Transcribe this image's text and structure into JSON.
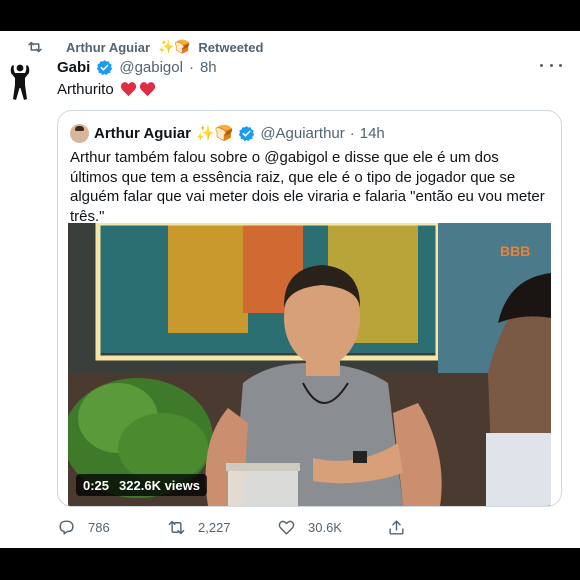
{
  "retweet": {
    "user": "Arthur Aguiar",
    "emoji": "✨🍞",
    "label": "Retweeted",
    "icon": "retweet-icon"
  },
  "tweet": {
    "name": "Gabi",
    "handle": "@gabigol",
    "dot": "·",
    "time": "8h",
    "text": "Arthurito",
    "hearts": [
      "heart-icon",
      "heart-icon"
    ],
    "more_icon": "more-icon"
  },
  "quote": {
    "name": "Arthur Aguiar",
    "emoji": "✨🍞",
    "handle": "@Aguiarthur",
    "dot": "·",
    "time": "14h",
    "text": "Arthur também falou sobre o @gabigol e disse que ele é um dos últimos que tem a essência raiz, que ele é o tipo de jogador que se alguém falar que vai meter dois ele viraria e falaria \"então eu vou meter três.\"",
    "video": {
      "duration": "0:25",
      "views": "322.6K views",
      "logo": "BBB"
    }
  },
  "actions": {
    "reply": {
      "icon": "reply-icon",
      "count": "786"
    },
    "retweet": {
      "icon": "retweet-icon",
      "count": "2,227"
    },
    "like": {
      "icon": "like-icon",
      "count": "30.6K"
    },
    "share": {
      "icon": "share-icon"
    }
  },
  "colors": {
    "verified": "#1d9bf0",
    "secondary": "#536471",
    "heart": "#e0245e",
    "border": "#cfd9de"
  }
}
